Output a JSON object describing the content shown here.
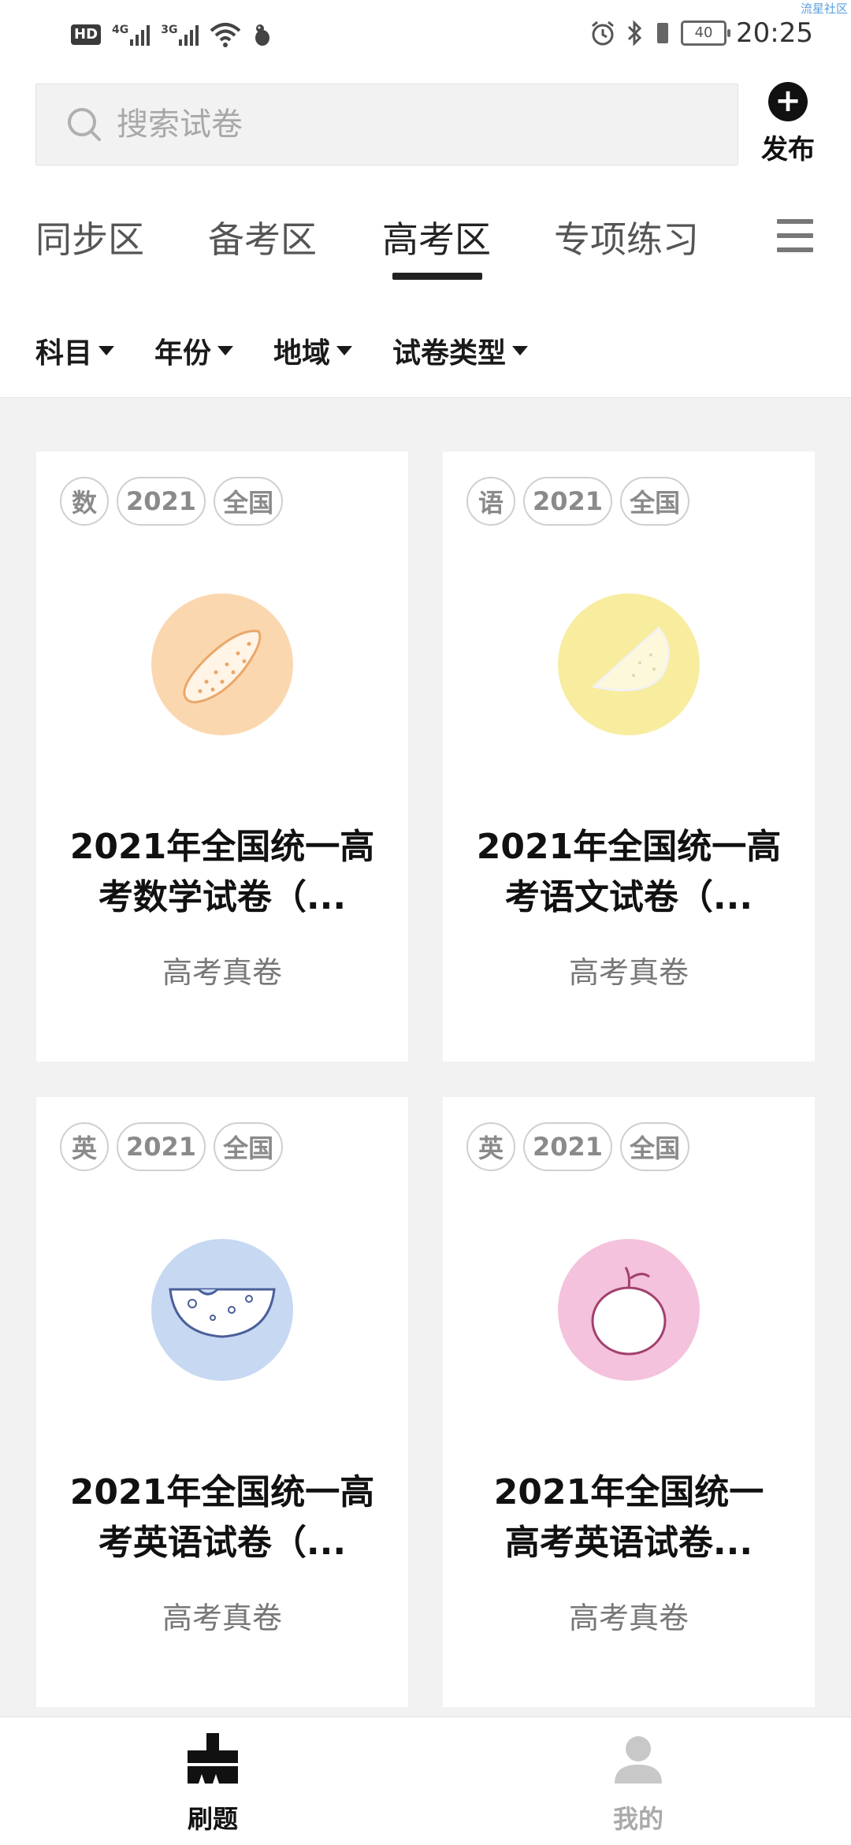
{
  "status_bar": {
    "left_badge": "HD",
    "sim1_label": "4G",
    "sim2_label": "3G",
    "battery": "40",
    "time": "20:25",
    "corner_text": "流星社区"
  },
  "search": {
    "placeholder": "搜索试卷"
  },
  "publish": {
    "label": "发布",
    "icon": "plus-circle-icon"
  },
  "tabs": [
    {
      "label": "同步区",
      "active": false
    },
    {
      "label": "备考区",
      "active": false
    },
    {
      "label": "高考区",
      "active": true
    },
    {
      "label": "专项练习",
      "active": false
    }
  ],
  "filters": [
    "科目",
    "年份",
    "地域",
    "试卷类型"
  ],
  "cards": [
    {
      "tags": [
        "数",
        "2021",
        "全国"
      ],
      "icon": "cucumber-icon",
      "icon_bg": "#fbd7b0",
      "title_line1": "2021年全国统一高",
      "title_line2": "考数学试卷（...",
      "subtitle": "高考真卷"
    },
    {
      "tags": [
        "语",
        "2021",
        "全国"
      ],
      "icon": "melon-slice-icon",
      "icon_bg": "#f8ec9f",
      "title_line1": "2021年全国统一高",
      "title_line2": "考语文试卷（...",
      "subtitle": "高考真卷"
    },
    {
      "tags": [
        "英",
        "2021",
        "全国"
      ],
      "icon": "cheese-icon",
      "icon_bg": "#c6d8f2",
      "title_line1": "2021年全国统一高",
      "title_line2": "考英语试卷（...",
      "subtitle": "高考真卷"
    },
    {
      "tags": [
        "英",
        "2021",
        "全国"
      ],
      "icon": "apple-icon",
      "icon_bg": "#f4c2dc",
      "title_line1": "2021年全国统一",
      "title_line2": "高考英语试卷...",
      "subtitle": "高考真卷"
    }
  ],
  "bottom_nav": [
    {
      "label": "刷题",
      "icon": "brush-icon",
      "active": true
    },
    {
      "label": "我的",
      "icon": "person-icon",
      "active": false
    }
  ]
}
